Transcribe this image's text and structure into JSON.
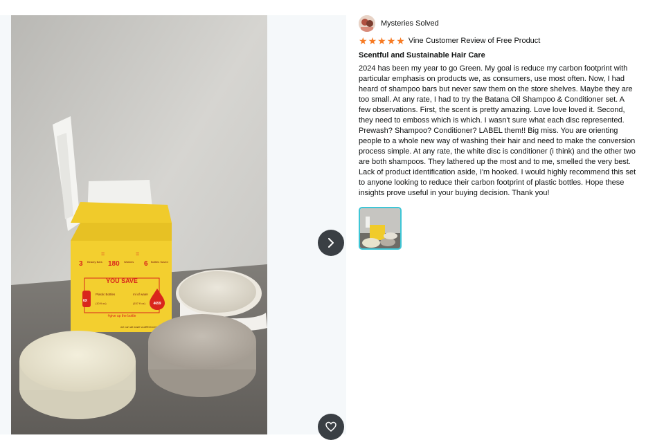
{
  "colors": {
    "star": "#f77b24",
    "thumbnail_border": "#3ec6d6",
    "button_bg": "#3a3f44"
  },
  "icons": {
    "next": "chevron-right-icon",
    "favorite": "heart-icon",
    "star": "star-icon"
  },
  "reviewer": {
    "name": "Mysteries Solved"
  },
  "review": {
    "rating_stars": 5,
    "star_glyph": "★",
    "badge": "Vine Customer Review of Free Product",
    "title": "Scentful and Sustainable Hair Care",
    "body": "2024 has been my year to go Green. My goal is reduce my carbon footprint with particular emphasis on products we, as consumers, use most often. Now, I had heard of shampoo bars but never saw them on the store shelves. Maybe they are too small. At any rate, I had to try the Batana Oil Shampoo & Conditioner set. A few observations. First, the scent is pretty amazing. Love love loved it. Second, they need to emboss which is which. I wasn't sure what each disc represented. Prewash? Shampoo? Conditioner? LABEL them!! Big miss. You are orienting people to a whole new way of washing their hair and need to make the conversion process simple. At any rate, the white disc is conditioner (i think) and the other two are both shampoos. They lathered up the most and to me, smelled the very best. Lack of product identification aside, I'm hooked. I would highly recommend this set to anyone looking to reduce their carbon footprint of plastic bottles. Hope these insights prove useful in your buying decision. Thank you!"
  },
  "photo": {
    "box_text": {
      "bars_value": "3",
      "bars_label": "Beauty Bars",
      "equals": "=",
      "washes_value": "180",
      "washes_label": "Washes",
      "bottles_value": "6",
      "bottles_label": "Bottles Saved",
      "you_save": "YOU SAVE",
      "plastic_count": "6X",
      "plastic_label": "Plastic Bottles",
      "plastic_sub": "(10 fl oz)",
      "water_label": "ml of water",
      "water_sub": "(157 fl oz)",
      "water_value": "4659",
      "hashtag": "#give up the bottle",
      "footer": "we can all make a difference!"
    }
  }
}
